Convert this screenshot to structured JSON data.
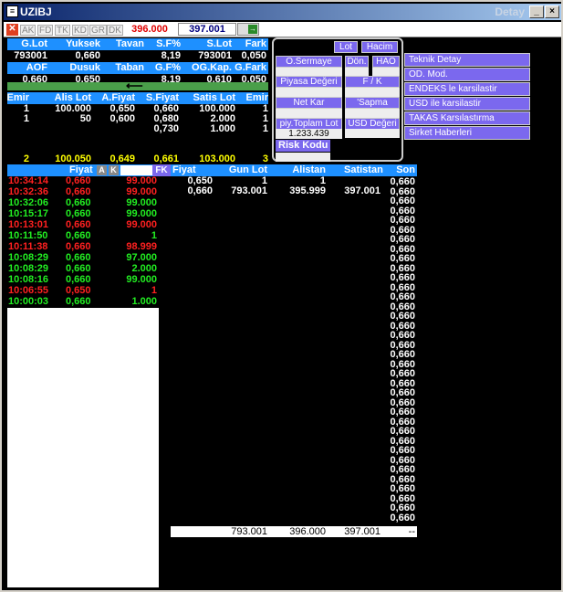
{
  "title": "UZIBJ",
  "detail": "Detay",
  "toolbar": {
    "tabs": [
      "AK",
      "FD",
      "TK",
      "KD",
      "GR",
      "DK"
    ],
    "price1": "396.000",
    "price2": "397.001"
  },
  "quote": {
    "h1": [
      "G.Lot",
      "Yuksek",
      "Tavan",
      "S.F%",
      "S.Lot",
      "Fark"
    ],
    "v1": [
      "793001",
      "0,660",
      "",
      "8,19",
      "793001",
      "0,050"
    ],
    "h2": [
      "AOF",
      "Dusuk",
      "Taban",
      "G.F%",
      "OG.Kap.",
      "G.Fark"
    ],
    "v2": [
      "0,660",
      "0,650",
      "",
      "8,19",
      "0,610",
      "0,050"
    ]
  },
  "depth": {
    "headers": [
      "Emir",
      "Alis Lot",
      "A.Fiyat",
      "S.Fiyat",
      "Satis Lot",
      "Emir"
    ],
    "rows": [
      [
        "1",
        "100.000",
        "0,650",
        "0,660",
        "100.000",
        "1"
      ],
      [
        "1",
        "50",
        "0,600",
        "0,680",
        "2.000",
        "1"
      ],
      [
        "",
        "",
        "",
        "0,730",
        "1.000",
        "1"
      ]
    ],
    "total": [
      "2",
      "100.050",
      "0,649",
      "0,661",
      "103.000",
      "3"
    ]
  },
  "panel": {
    "lot": "Lot",
    "hacim": "Hacim",
    "sermaye": "O.Sermaye",
    "don": "Dön.",
    "hao": "HAO",
    "piyasa": "Piyasa Değeri",
    "fk": "F / K",
    "netkar": "Net Kar",
    "sapma": "'Sapma",
    "piytop": "piy.Toplam Lot",
    "usd": "USD Değeri",
    "piytop_val": "1.233.439",
    "risk": "Risk Kodu"
  },
  "menu": [
    "Teknik Detay",
    "OD. Mod.",
    "ENDEKS le karsilastir",
    "USD ile karsilastir",
    "TAKAS Karsılastırma",
    "Sirket Haberleri"
  ],
  "trades": {
    "header": "Fiyat",
    "btnA": "A",
    "btnK": "K",
    "btnFK": "FK",
    "rows": [
      [
        "10:34:14",
        "0,660",
        "99.000",
        "r"
      ],
      [
        "10:32:36",
        "0,660",
        "99.000",
        "r"
      ],
      [
        "10:32:06",
        "0,660",
        "99.000",
        "g"
      ],
      [
        "10:15:17",
        "0,660",
        "99.000",
        "g"
      ],
      [
        "10:13:01",
        "0,660",
        "99.000",
        "r"
      ],
      [
        "10:11:50",
        "0,660",
        "1",
        "g"
      ],
      [
        "10:11:38",
        "0,660",
        "98.999",
        "r"
      ],
      [
        "10:08:29",
        "0,660",
        "97.000",
        "g"
      ],
      [
        "10:08:29",
        "0,660",
        "2.000",
        "g"
      ],
      [
        "10:08:16",
        "0,660",
        "99.000",
        "g"
      ],
      [
        "10:06:55",
        "0,650",
        "1",
        "r"
      ],
      [
        "10:00:03",
        "0,660",
        "1.000",
        "g"
      ]
    ]
  },
  "stats": {
    "headers": [
      "Fiyat",
      "Gun Lot",
      "Alistan",
      "Satistan",
      "Son"
    ],
    "rows": [
      [
        "0,650",
        "1",
        "1",
        "",
        ""
      ],
      [
        "0,660",
        "793.001",
        "395.999",
        "397.001",
        ""
      ]
    ],
    "son": "0,660",
    "son_count": 36,
    "footer": [
      "793.001",
      "396.000",
      "397.001",
      "--"
    ]
  }
}
